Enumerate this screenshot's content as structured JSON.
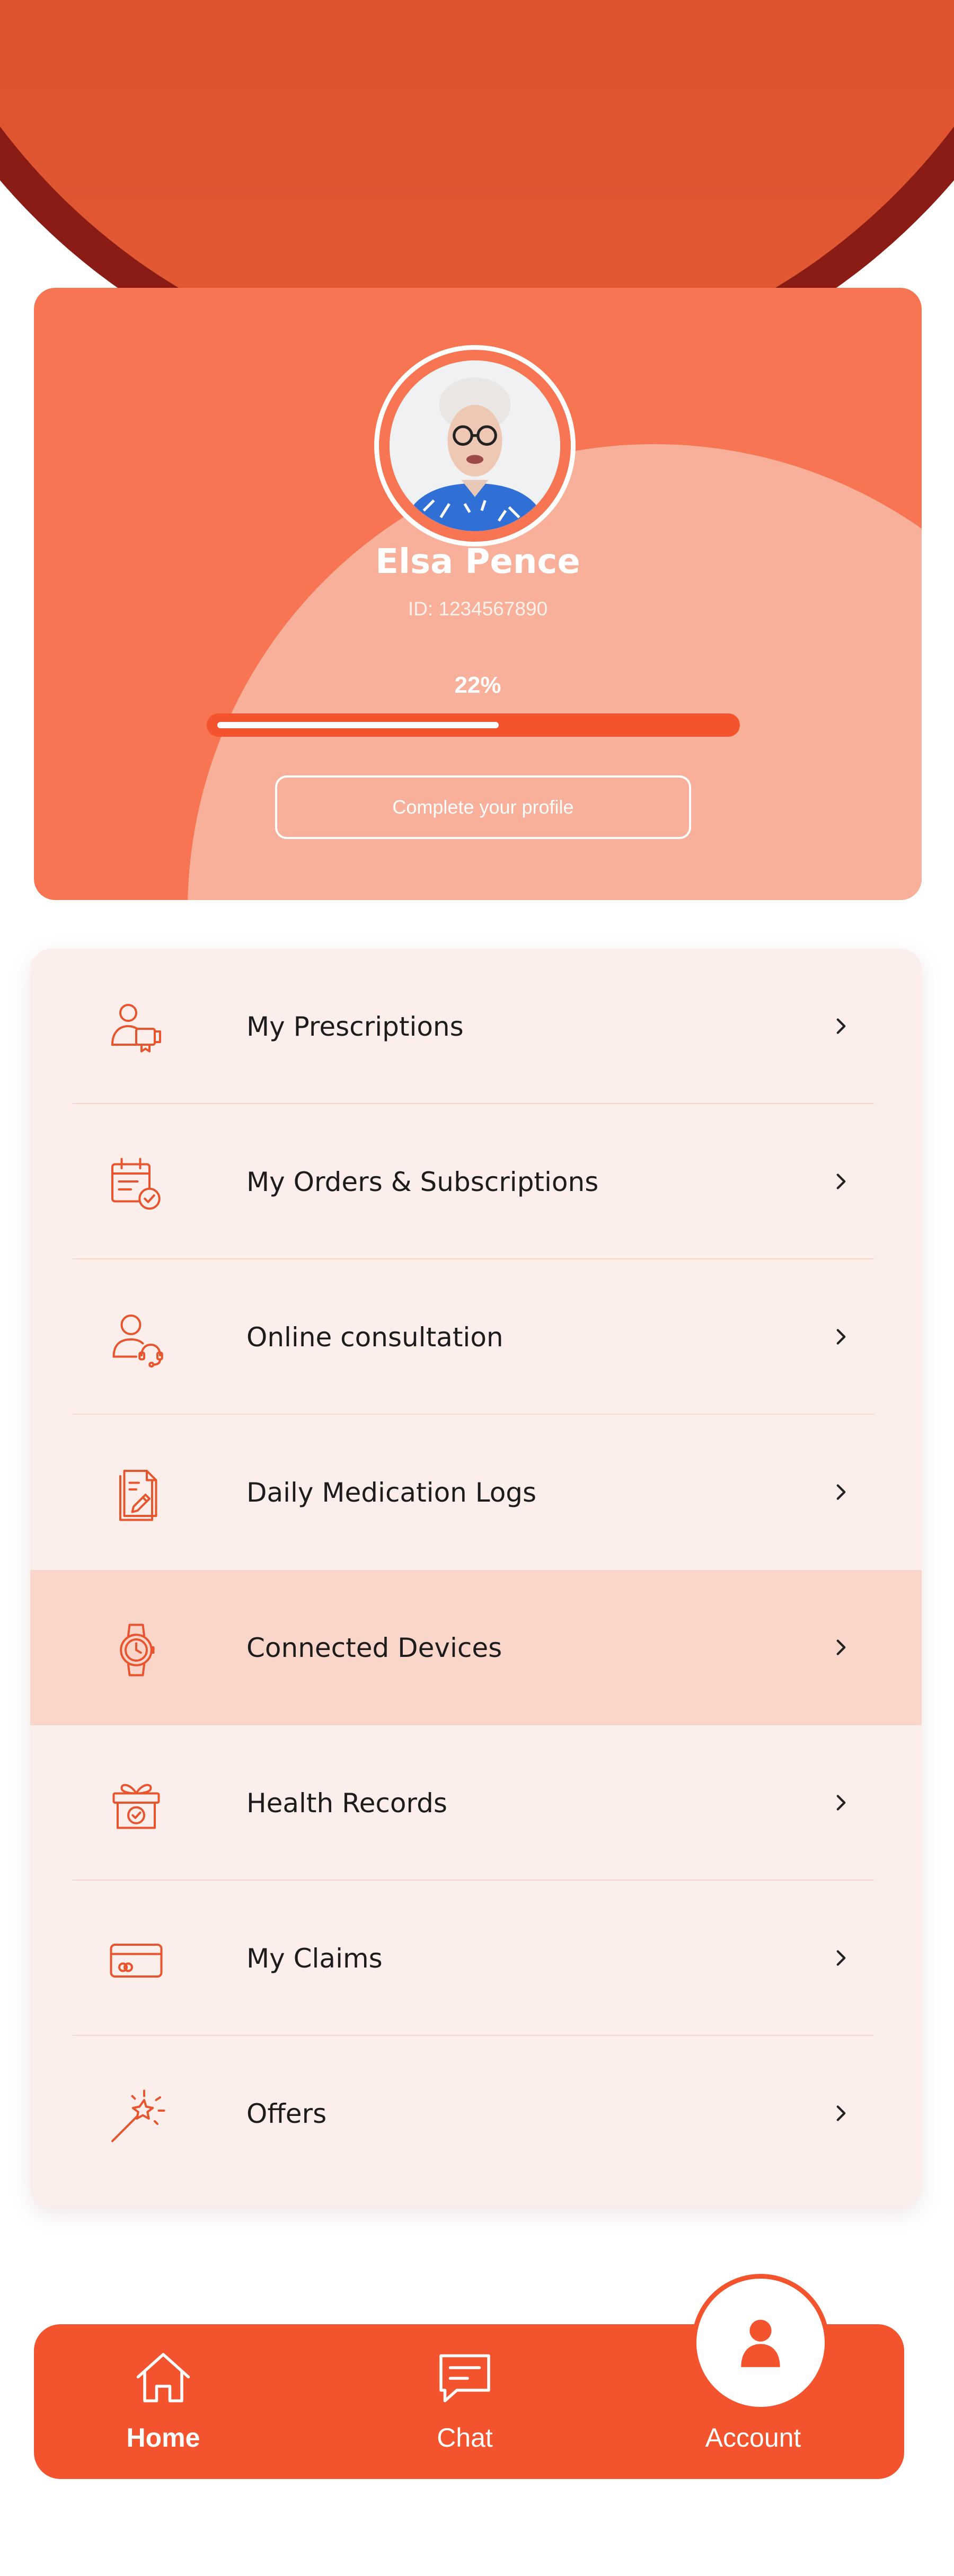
{
  "theme": {
    "accent": "#f4542d",
    "header_bg": "#d2401b",
    "card_bg": "#f77552",
    "menu_bg": "#fbeeeb",
    "active_row_bg": "#f9d5ca"
  },
  "profile": {
    "name": "Elsa Pence",
    "id_text": "ID: 1234567890",
    "completion_percent": 22,
    "completion_label": "22%",
    "progress_bar_fill_fraction": 0.55,
    "complete_button": "Complete your profile",
    "avatar": "user-photo"
  },
  "menu": {
    "items": [
      {
        "label": "My Prescriptions",
        "icon": "prescription-icon"
      },
      {
        "label": "My Orders & Subscriptions",
        "icon": "orders-calendar-icon"
      },
      {
        "label": "Online consultation",
        "icon": "consultation-headset-icon"
      },
      {
        "label": "Daily Medication Logs",
        "icon": "medication-log-icon"
      },
      {
        "label": "Connected Devices",
        "icon": "smartwatch-icon",
        "active": true
      },
      {
        "label": "Health Records",
        "icon": "health-records-icon"
      },
      {
        "label": "My Claims",
        "icon": "credit-card-icon"
      },
      {
        "label": "Offers",
        "icon": "magic-wand-icon"
      }
    ],
    "chevron_icon": "chevron-right-icon"
  },
  "nav": {
    "home": "Home",
    "chat": "Chat",
    "account": "Account",
    "active": "Account"
  }
}
